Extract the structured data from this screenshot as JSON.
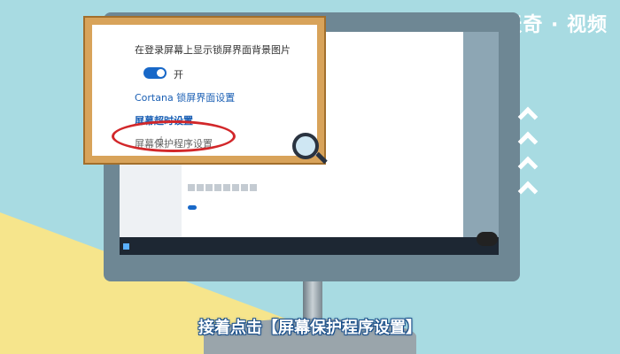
{
  "watermark": "天奇 · 视频",
  "zoom_panel": {
    "show_background_label": "在登录屏幕上显示锁屏界面背景图片",
    "toggle_state": "开",
    "cortana_link": "Cortana 锁屏界面设置",
    "timeout_link": "屏幕超时设置",
    "screensaver_link": "屏幕保护程序设置"
  },
  "caption": "接着点击【屏幕保护程序设置】"
}
